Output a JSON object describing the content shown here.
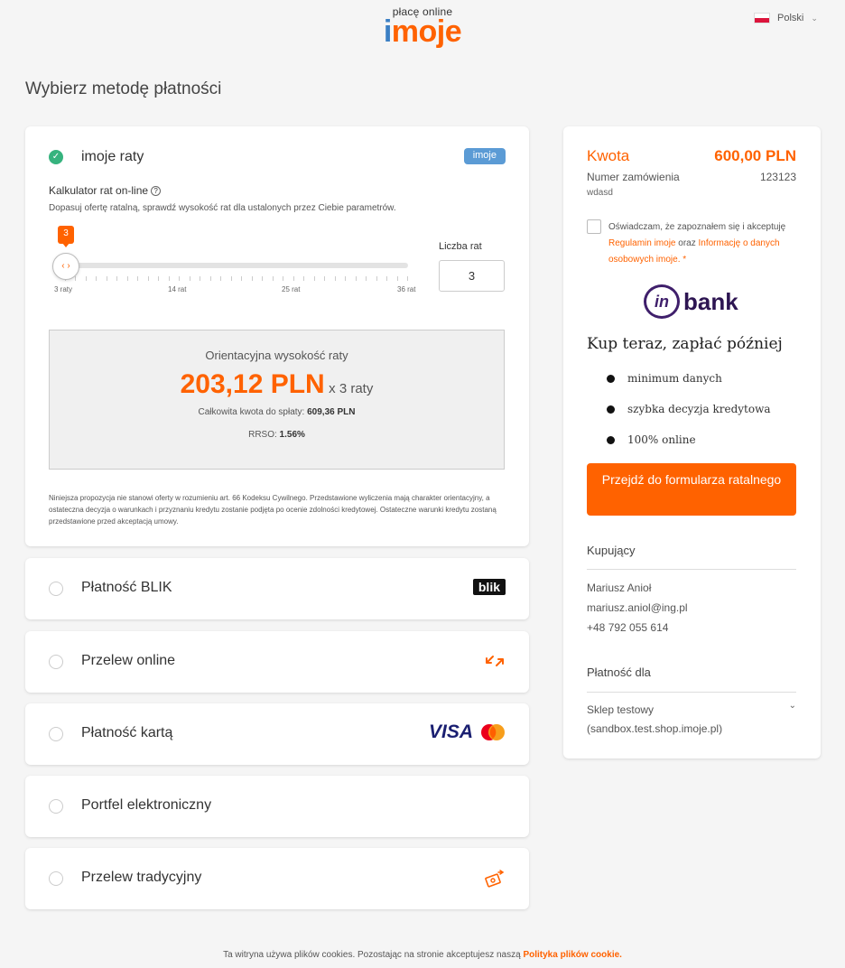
{
  "header": {
    "logo_top": "płacę online",
    "logo_i": "i",
    "logo_rest": "moje",
    "language": "Polski"
  },
  "page_title": "Wybierz metodę płatności",
  "raty": {
    "title": "imoje raty",
    "badge": "imoje",
    "calc_title": "Kalkulator rat on-line",
    "calc_sub": "Dopasuj ofertę ratalną, sprawdź wysokość rat dla ustalonych przez Ciebie parametrów.",
    "slider_value": "3",
    "tick_labels": [
      "3 raty",
      "14 rat",
      "25 rat",
      "36 rat"
    ],
    "liczba_label": "Liczba rat",
    "liczba_value": "3",
    "result_label": "Orientacyjna wysokość raty",
    "result_amount": "203,12 PLN",
    "result_x": "x 3 raty",
    "total_label": "Całkowita kwota do spłaty:",
    "total_value": "609,36 PLN",
    "rrso_label": "RRSO:",
    "rrso_value": "1.56%",
    "disclaimer": "Niniejsza propozycja nie stanowi oferty w rozumieniu art. 66 Kodeksu Cywilnego. Przedstawione wyliczenia mają charakter orientacyjny, a ostateczna decyzja o warunkach i przyznaniu kredytu zostanie podjęta po ocenie zdolności kredytowej. Ostateczne warunki kredytu zostaną przedstawione przed akceptacją umowy."
  },
  "methods": [
    {
      "label": "Płatność BLIK",
      "logo": "blik"
    },
    {
      "label": "Przelew online",
      "logo": "arrows"
    },
    {
      "label": "Płatność kartą",
      "logo": "visa-mastercard"
    },
    {
      "label": "Portfel elektroniczny",
      "logo": ""
    },
    {
      "label": "Przelew tradycyjny",
      "logo": "transfer"
    }
  ],
  "method_logos": {
    "blik": "blik",
    "visa": "VISA"
  },
  "summary": {
    "kwota_label": "Kwota",
    "kwota_value": "600,00 PLN",
    "order_label": "Numer zamówienia",
    "order_value": "123123",
    "order_sub": "wdasd",
    "consent_pre": "Oświadczam, że zapoznałem się i akceptuję ",
    "consent_link1": "Regulamin imoje",
    "consent_mid": " oraz ",
    "consent_link2": "Informację o danych osobowych imoje.",
    "consent_star": " *",
    "inbank_in": "in",
    "inbank_bank": "bank",
    "kup": "Kup teraz, zapłać później",
    "bullets": [
      "minimum danych",
      "szybka decyzja kredytowa",
      "100% online"
    ],
    "cta": "Przejdź do formularza ratalnego",
    "buyer_title": "Kupujący",
    "buyer_name": "Mariusz Anioł",
    "buyer_email": "mariusz.aniol@ing.pl",
    "buyer_phone": "+48 792 055 614",
    "payfor_title": "Płatność dla",
    "shop_name": "Sklep testowy",
    "shop_url": "(sandbox.test.shop.imoje.pl)"
  },
  "footer": {
    "text": "Ta witryna używa plików cookies. Pozostając na stronie akceptujesz naszą ",
    "link": "Polityka plików cookie."
  },
  "colors": {
    "accent": "#ff6200",
    "success": "#36b37e",
    "inbank": "#3f1f6b",
    "imoje_blue": "#5b9bd5"
  }
}
